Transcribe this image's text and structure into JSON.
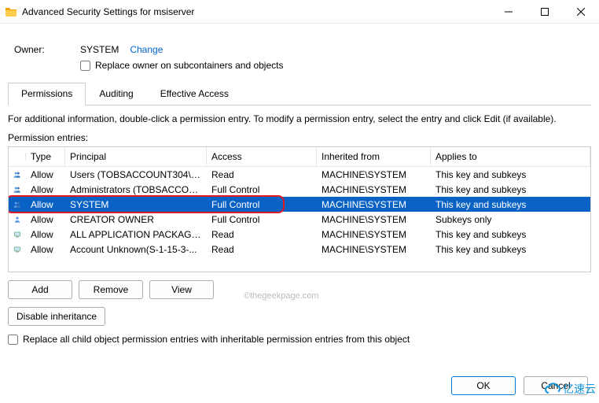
{
  "window": {
    "title": "Advanced Security Settings for msiserver"
  },
  "owner": {
    "label": "Owner:",
    "name": "SYSTEM",
    "change": "Change",
    "replace_cb": "Replace owner on subcontainers and objects"
  },
  "tabs": {
    "permissions": "Permissions",
    "auditing": "Auditing",
    "effective": "Effective Access"
  },
  "info_text": "For additional information, double-click a permission entry. To modify a permission entry, select the entry and click Edit (if available).",
  "entries_label": "Permission entries:",
  "columns": {
    "type": "Type",
    "principal": "Principal",
    "access": "Access",
    "inherited": "Inherited from",
    "applies": "Applies to"
  },
  "rows": [
    {
      "icon": "users",
      "type": "Allow",
      "principal": "Users (TOBSACCOUNT304\\Us...",
      "access": "Read",
      "inherited": "MACHINE\\SYSTEM",
      "applies": "This key and subkeys",
      "selected": false
    },
    {
      "icon": "users",
      "type": "Allow",
      "principal": "Administrators (TOBSACCOU...",
      "access": "Full Control",
      "inherited": "MACHINE\\SYSTEM",
      "applies": "This key and subkeys",
      "selected": false
    },
    {
      "icon": "users",
      "type": "Allow",
      "principal": "SYSTEM",
      "access": "Full Control",
      "inherited": "MACHINE\\SYSTEM",
      "applies": "This key and subkeys",
      "selected": true
    },
    {
      "icon": "user",
      "type": "Allow",
      "principal": "CREATOR OWNER",
      "access": "Full Control",
      "inherited": "MACHINE\\SYSTEM",
      "applies": "Subkeys only",
      "selected": false
    },
    {
      "icon": "computer",
      "type": "Allow",
      "principal": "ALL APPLICATION PACKAGES",
      "access": "Read",
      "inherited": "MACHINE\\SYSTEM",
      "applies": "This key and subkeys",
      "selected": false
    },
    {
      "icon": "computer",
      "type": "Allow",
      "principal": "Account Unknown(S-1-15-3-...",
      "access": "Read",
      "inherited": "MACHINE\\SYSTEM",
      "applies": "This key and subkeys",
      "selected": false
    }
  ],
  "buttons": {
    "add": "Add",
    "remove": "Remove",
    "view": "View",
    "disable_inherit": "Disable inheritance",
    "replace_all": "Replace all child object permission entries with inheritable permission entries from this object",
    "ok": "OK",
    "cancel": "Cancel"
  },
  "watermark": "©thegeekpage.com",
  "brand": "亿速云"
}
